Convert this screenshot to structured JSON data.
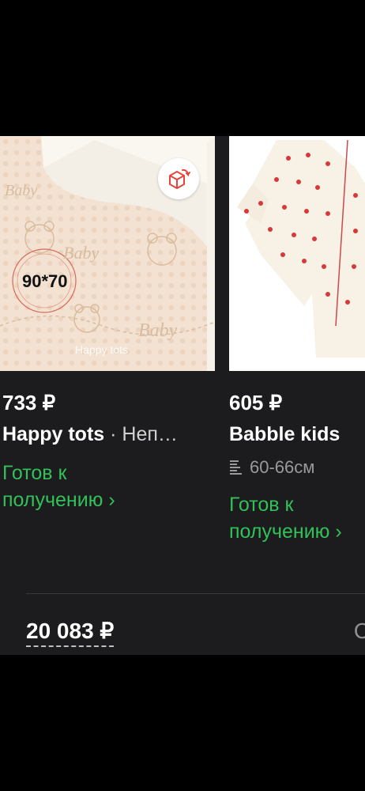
{
  "products": [
    {
      "price": "733 ₽",
      "brand": "Happy tots",
      "separator": " · ",
      "subtitle": "Неп…",
      "image_overlay_size": "90*70",
      "image_watermark": "Happy tots",
      "image_print_text": "Baby",
      "status": "Готов к получению",
      "status_line1": "Готов к",
      "status_line2": "получению ›",
      "badge_icon": "box-return-icon"
    },
    {
      "price": "605 ₽",
      "brand": "Babble kids",
      "size": "60-66см",
      "size_icon": "size-lines-icon",
      "status_line1": "Готов к",
      "status_line2": "получению ›"
    }
  ],
  "cart": {
    "total": "20 083 ₽",
    "edge_char": "С"
  },
  "colors": {
    "background": "#000000",
    "panel": "#1c1c1e",
    "status_green": "#31c158",
    "text": "#ffffff"
  }
}
